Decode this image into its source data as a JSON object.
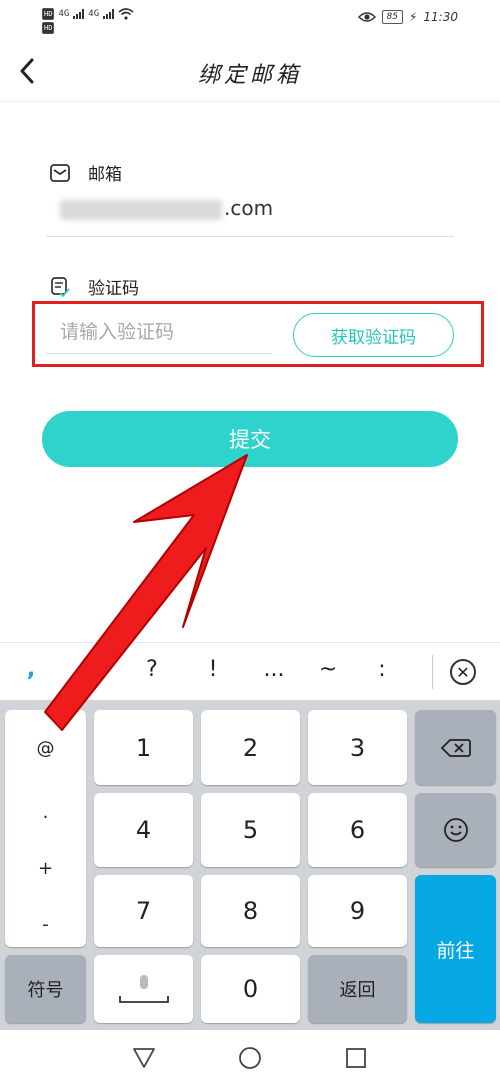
{
  "status_bar": {
    "network_1": "4G",
    "network_2": "4G",
    "battery": "85",
    "time": "11:30"
  },
  "header": {
    "title": "绑定邮箱"
  },
  "email_field": {
    "label": "邮箱",
    "value_suffix": ".com"
  },
  "code_field": {
    "label": "验证码",
    "placeholder": "请输入验证码",
    "get_code_label": "获取验证码"
  },
  "submit": {
    "label": "提交"
  },
  "keyboard": {
    "symbols": [
      ",",
      "?",
      "!",
      "...",
      "~",
      ":"
    ],
    "side_keys": [
      "@",
      ".",
      "+",
      "-"
    ],
    "digits": [
      "1",
      "2",
      "3",
      "4",
      "5",
      "6",
      "7",
      "8",
      "9",
      "0"
    ],
    "symbol_key": "符号",
    "return_key": "返回",
    "go_key": "前往"
  },
  "nav": {
    "back_icon": "triangle-back-icon",
    "home_icon": "circle-home-icon",
    "recent_icon": "square-recent-icon"
  },
  "colors": {
    "accent": "#2fd3cb",
    "annotation": "#e02020",
    "go_key": "#06a8e4"
  }
}
